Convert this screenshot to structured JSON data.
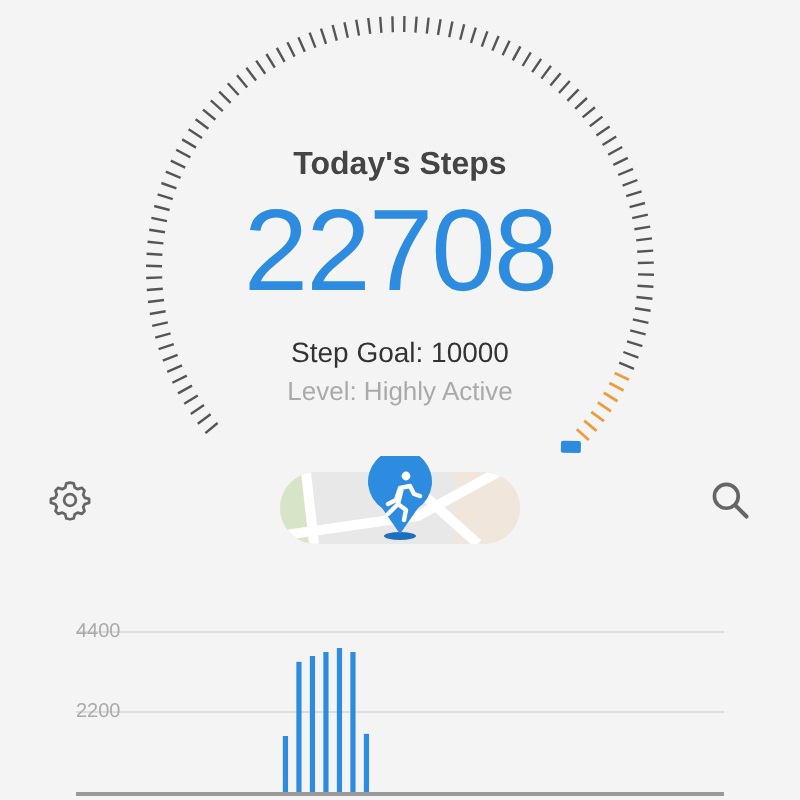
{
  "summary": {
    "title": "Today's Steps",
    "steps": "22708",
    "goal": "Step Goal: 10000",
    "level_text": "Level: Highly Active"
  },
  "chart": {
    "chart_data": {
      "type": "bar",
      "categories": [
        null,
        null,
        null,
        null,
        null,
        null,
        null,
        null,
        null,
        null,
        null,
        null,
        null,
        null,
        null,
        null,
        null,
        null,
        null,
        null,
        null,
        null,
        null,
        null,
        null,
        null,
        null,
        null,
        null,
        null,
        null,
        null,
        null,
        null,
        null,
        null,
        null,
        null,
        null,
        null,
        null,
        null,
        null,
        null,
        null,
        null,
        null,
        null
      ],
      "values": [
        0,
        0,
        0,
        0,
        0,
        0,
        0,
        0,
        0,
        0,
        0,
        0,
        0,
        0,
        0,
        1540,
        3580,
        3740,
        3850,
        3960,
        3850,
        1600,
        0,
        0,
        0,
        0,
        0,
        0,
        0,
        0,
        0,
        0,
        0,
        0,
        0,
        0,
        0,
        0,
        0,
        0,
        0,
        0,
        0,
        0,
        0,
        0,
        0,
        0
      ],
      "ylim": [
        0,
        4400
      ],
      "yticks": [
        2200,
        4400
      ]
    }
  }
}
